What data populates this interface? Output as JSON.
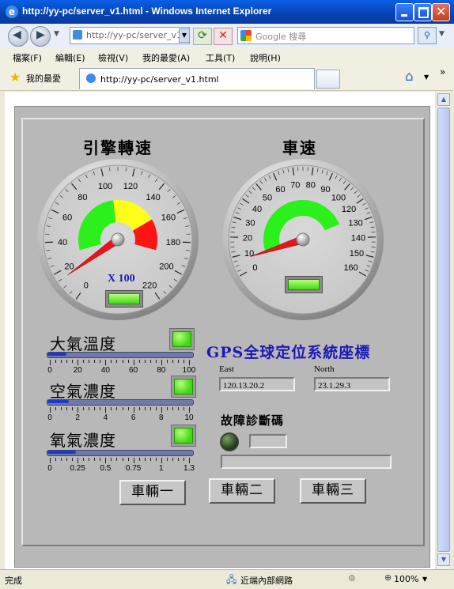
{
  "window": {
    "title": "http://yy-pc/server_v1.html - Windows Internet Explorer"
  },
  "addressbar": {
    "url": "http://yy-pc/server_v1.",
    "search_placeholder": "Google 搜尋"
  },
  "menu": {
    "items": [
      "檔案(F)",
      "編輯(E)",
      "檢視(V)",
      "我的最愛(A)",
      "工具(T)",
      "說明(H)"
    ]
  },
  "favorites": {
    "label": "我的最愛",
    "tab_title": "http://yy-pc/server_v1.html"
  },
  "gauges": {
    "engine": {
      "title": "引擎轉速",
      "multiplier": "X 100",
      "min": 0,
      "max": 220,
      "ticks": [
        "0",
        "20",
        "40",
        "60",
        "80",
        "100",
        "120",
        "140",
        "160",
        "180",
        "200",
        "220"
      ],
      "value": 15
    },
    "speed": {
      "title": "車速",
      "min": 0,
      "max": 160,
      "ticks": [
        "0",
        "10",
        "20",
        "30",
        "40",
        "50",
        "60",
        "70",
        "80",
        "90",
        "100",
        "120",
        "130",
        "140",
        "150",
        "160"
      ],
      "value": 8
    }
  },
  "sliders": {
    "temperature": {
      "label": "大氣溫度",
      "ticks": [
        "0",
        "20",
        "40",
        "60",
        "80",
        "100"
      ],
      "value_fraction": 0.13
    },
    "air": {
      "label": "空氣濃度",
      "ticks": [
        "0",
        "2",
        "4",
        "6",
        "8",
        "10"
      ],
      "value_fraction": 0.15
    },
    "oxygen": {
      "label": "氧氣濃度",
      "ticks": [
        "0",
        "0.25",
        "0.5",
        "0.75",
        "1",
        "1.3"
      ],
      "value_fraction": 0.2
    }
  },
  "gps": {
    "title": "GPS全球定位系統座標",
    "east_label": "East",
    "east_value": "120.13.20.2",
    "north_label": "North",
    "north_value": "23.1.29.3"
  },
  "diagnostic": {
    "title": "故障診斷碼"
  },
  "buttons": [
    "車輛一",
    "車輛二",
    "車輛三"
  ],
  "status": {
    "left": "完成",
    "zone": "近端內部網路",
    "zoom": "100%"
  },
  "colors": {
    "titlebar": "#0842b0",
    "green_zone": "#2cf01c",
    "yellow_zone": "#ffff1a",
    "red_zone": "#ff1414",
    "needle": "#e8141c",
    "led_green": "#3fd913",
    "gps_title": "#1a1ab4"
  }
}
